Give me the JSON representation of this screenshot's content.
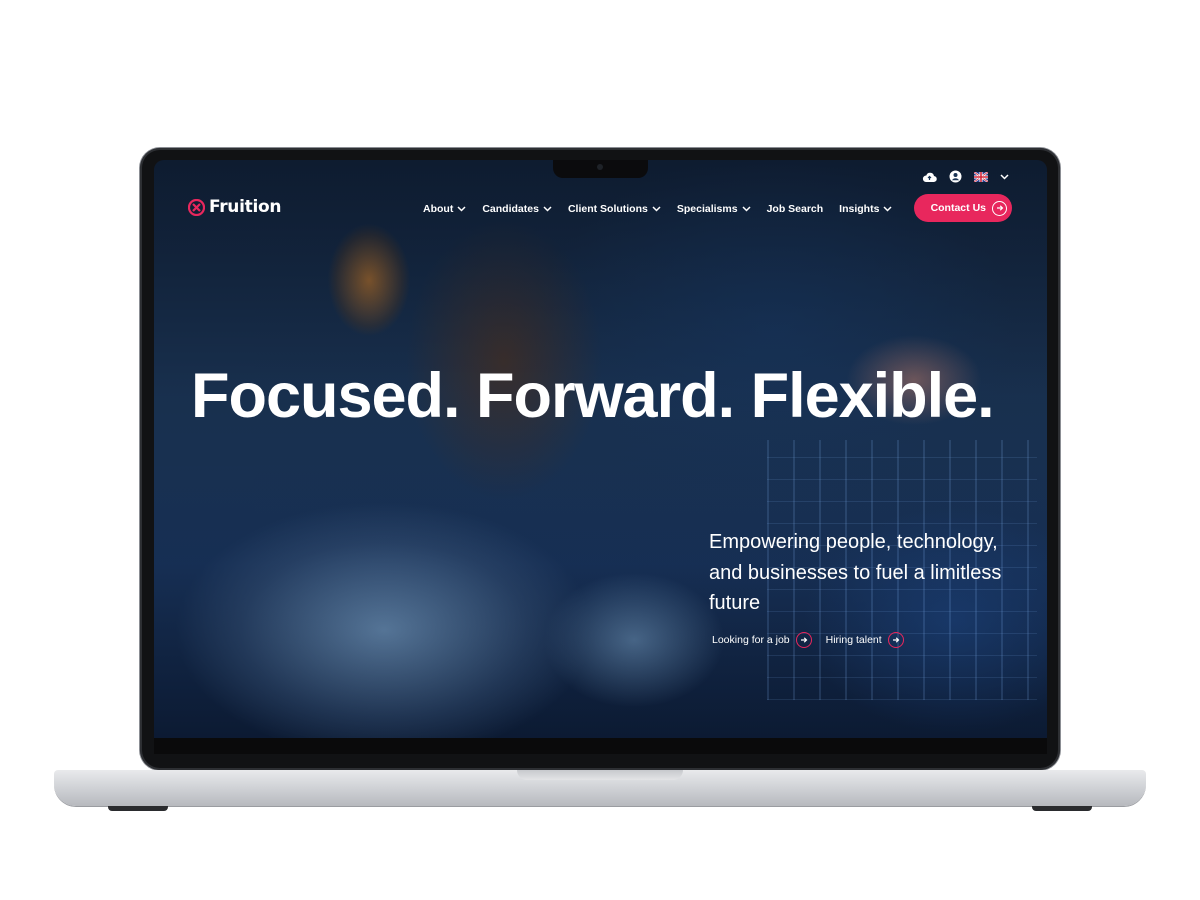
{
  "brand": {
    "name": "Fruition",
    "accent": "#e8275d"
  },
  "utility": {
    "icons": [
      "cloud-upload-icon",
      "account-icon",
      "uk-flag-icon",
      "chevron-down-icon"
    ]
  },
  "nav": {
    "items": [
      {
        "label": "About",
        "has_dropdown": true
      },
      {
        "label": "Candidates",
        "has_dropdown": true
      },
      {
        "label": "Client Solutions",
        "has_dropdown": true
      },
      {
        "label": "Specialisms",
        "has_dropdown": true
      },
      {
        "label": "Job Search",
        "has_dropdown": false
      },
      {
        "label": "Insights",
        "has_dropdown": true
      }
    ],
    "contact_label": "Contact Us"
  },
  "hero": {
    "headline": "Focused. Forward. Flexible.",
    "tagline": "Empowering people, technology, and businesses to fuel a limitless future",
    "cta_primary": "Looking for a job",
    "cta_secondary": "Hiring talent"
  }
}
